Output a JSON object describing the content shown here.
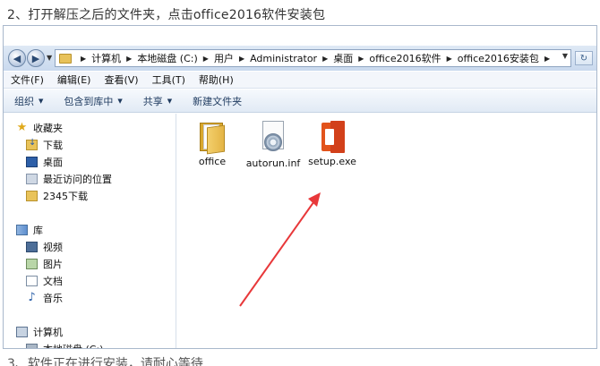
{
  "captions": {
    "step2": "2、打开解压之后的文件夹，点击office2016软件安装包",
    "step3": "3、软件正在进行安装，请耐心等待"
  },
  "address_bar": {
    "crumbs": [
      "计算机",
      "本地磁盘 (C:)",
      "用户",
      "Administrator",
      "桌面",
      "office2016软件",
      "office2016安装包"
    ]
  },
  "menu": [
    "文件(F)",
    "编辑(E)",
    "查看(V)",
    "工具(T)",
    "帮助(H)"
  ],
  "toolbar": {
    "organize": "组织",
    "include_library": "包含到库中",
    "share": "共享",
    "new_folder": "新建文件夹"
  },
  "navpane": {
    "favorites": {
      "label": "收藏夹",
      "items": [
        "下载",
        "桌面",
        "最近访问的位置",
        "2345下载"
      ]
    },
    "libraries": {
      "label": "库",
      "items": [
        "视频",
        "图片",
        "文档",
        "音乐"
      ]
    },
    "computer": {
      "label": "计算机",
      "items": [
        "本地磁盘 (C:)"
      ]
    }
  },
  "files": [
    {
      "name": "office",
      "type": "folder"
    },
    {
      "name": "autorun.inf",
      "type": "inf"
    },
    {
      "name": "setup.exe",
      "type": "office-exe"
    }
  ],
  "colors": {
    "annotation_arrow": "#e8383a",
    "office_brand": "#d83b01"
  }
}
